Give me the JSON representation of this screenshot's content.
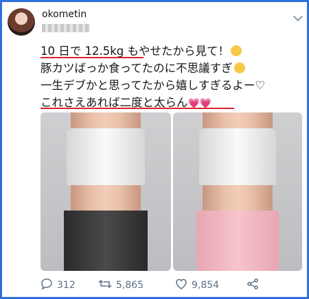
{
  "tweet": {
    "author_name": "okometin",
    "lines": [
      "10 日で 12.5kg もやせたから見て！",
      "豚カツばっか食ってたのに不思議すぎ",
      "一生デブかと思ってたから嬉しすぎるよー♡",
      "これさえあれば二度と太らん"
    ],
    "hearts": "💗💗"
  },
  "actions": {
    "replies": "312",
    "retweets": "5,865",
    "likes": "9,854"
  },
  "icons": [
    "reply-icon",
    "retweet-icon",
    "like-icon",
    "share-icon",
    "chevron-down-icon"
  ],
  "colors": {
    "frame": "#2f6fdb",
    "underline": "#d9232c"
  }
}
